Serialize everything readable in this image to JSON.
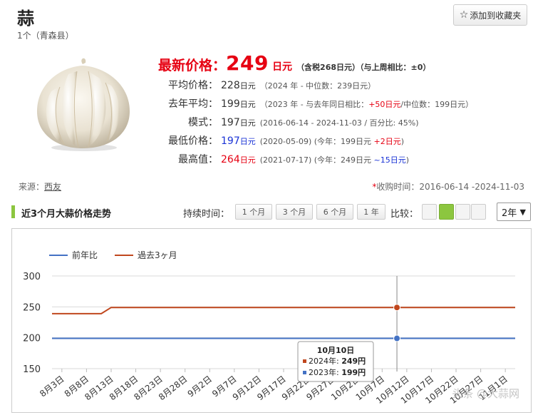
{
  "product": {
    "title": "蒜",
    "subtitle": "1个（青森县）"
  },
  "favorite_button": {
    "label": "添加到收藏夹",
    "icon": "star-icon"
  },
  "price": {
    "latest_label": "最新价格：",
    "latest_value": "249",
    "latest_unit": "日元",
    "latest_note": "（含税268日元）（与上周相比：±0）"
  },
  "stats": [
    {
      "label": "平均价格：",
      "value": "228",
      "unit": "日元",
      "detail_parts": [
        {
          "text": "（2024 年 - 中位数：239日元）",
          "color": ""
        }
      ]
    },
    {
      "label": "去年平均：",
      "value": "199",
      "unit": "日元",
      "detail_parts": [
        {
          "text": "（2023 年 - 与去年同日相比：",
          "color": ""
        },
        {
          "text": "+50日元",
          "color": "red"
        },
        {
          "text": "/中位数：199日元）",
          "color": ""
        }
      ]
    },
    {
      "label": "模式：",
      "value": "197",
      "unit": "日元",
      "detail_parts": [
        {
          "text": "(2016-06-14 - 2024-11-03 / 百分比: 45%)",
          "color": ""
        }
      ]
    },
    {
      "label": "最低价格：",
      "value": "197",
      "unit": "日元",
      "value_color": "blue",
      "detail_parts": [
        {
          "text": "(2020-05-09) (今年：199日元 ",
          "color": ""
        },
        {
          "text": "+2日元",
          "color": "red"
        },
        {
          "text": ")",
          "color": ""
        }
      ]
    },
    {
      "label": "最高值：",
      "value": "264",
      "unit": "日元",
      "value_color": "red",
      "detail_parts": [
        {
          "text": "(2021-07-17) (今年：249日元 ",
          "color": ""
        },
        {
          "text": "~15日元",
          "color": "blue"
        },
        {
          "text": ")",
          "color": ""
        }
      ]
    }
  ],
  "source": {
    "label": "来源：",
    "link": "西友"
  },
  "collection_period": {
    "asterisk": "*",
    "text": "收购时间：2016-06-14 -2024-11-03"
  },
  "section": {
    "title": "近3个月大蒜价格走势",
    "duration_label": "持续时间：",
    "duration_tabs": [
      "1 个月",
      "3 个月",
      "6 个月",
      "1 年"
    ],
    "compare_label": "比较：",
    "year_select": "2年"
  },
  "colors": {
    "accent_green": "#8cc63f",
    "series_blue": "#4472c4",
    "series_orange": "#c0471e",
    "price_red": "#e60012"
  },
  "chart_data": {
    "type": "line",
    "legend": [
      "前年比",
      "過去3ヶ月"
    ],
    "x_tick_labels": [
      "8月3日",
      "8月8日",
      "8月13日",
      "8月18日",
      "8月23日",
      "8月28日",
      "9月2日",
      "9月7日",
      "9月12日",
      "9月17日",
      "9月22日",
      "9月27日",
      "10月2日",
      "10月7日",
      "10月12日",
      "10月17日",
      "10月22日",
      "10月27日",
      "11月1日"
    ],
    "y_ticks": [
      150,
      200,
      250,
      300
    ],
    "ylim": [
      150,
      300
    ],
    "series": [
      {
        "name": "前年比",
        "color": "#4472c4",
        "points": [
          [
            "2023-08-01",
            199
          ],
          [
            "2023-11-03",
            199
          ]
        ]
      },
      {
        "name": "過去3ヶ月",
        "color": "#c0471e",
        "points": [
          [
            "2024-08-01",
            239
          ],
          [
            "2024-08-11",
            239
          ],
          [
            "2024-08-13",
            249
          ],
          [
            "2024-11-03",
            249
          ]
        ]
      }
    ],
    "tooltip": {
      "date": "10月10日",
      "rows": [
        {
          "label": "2024年: ",
          "value": "249円",
          "color": "#c0471e"
        },
        {
          "label": "2023年: ",
          "value": "199円",
          "color": "#4472c4"
        }
      ]
    }
  },
  "watermark": "头条 @大蒜网"
}
